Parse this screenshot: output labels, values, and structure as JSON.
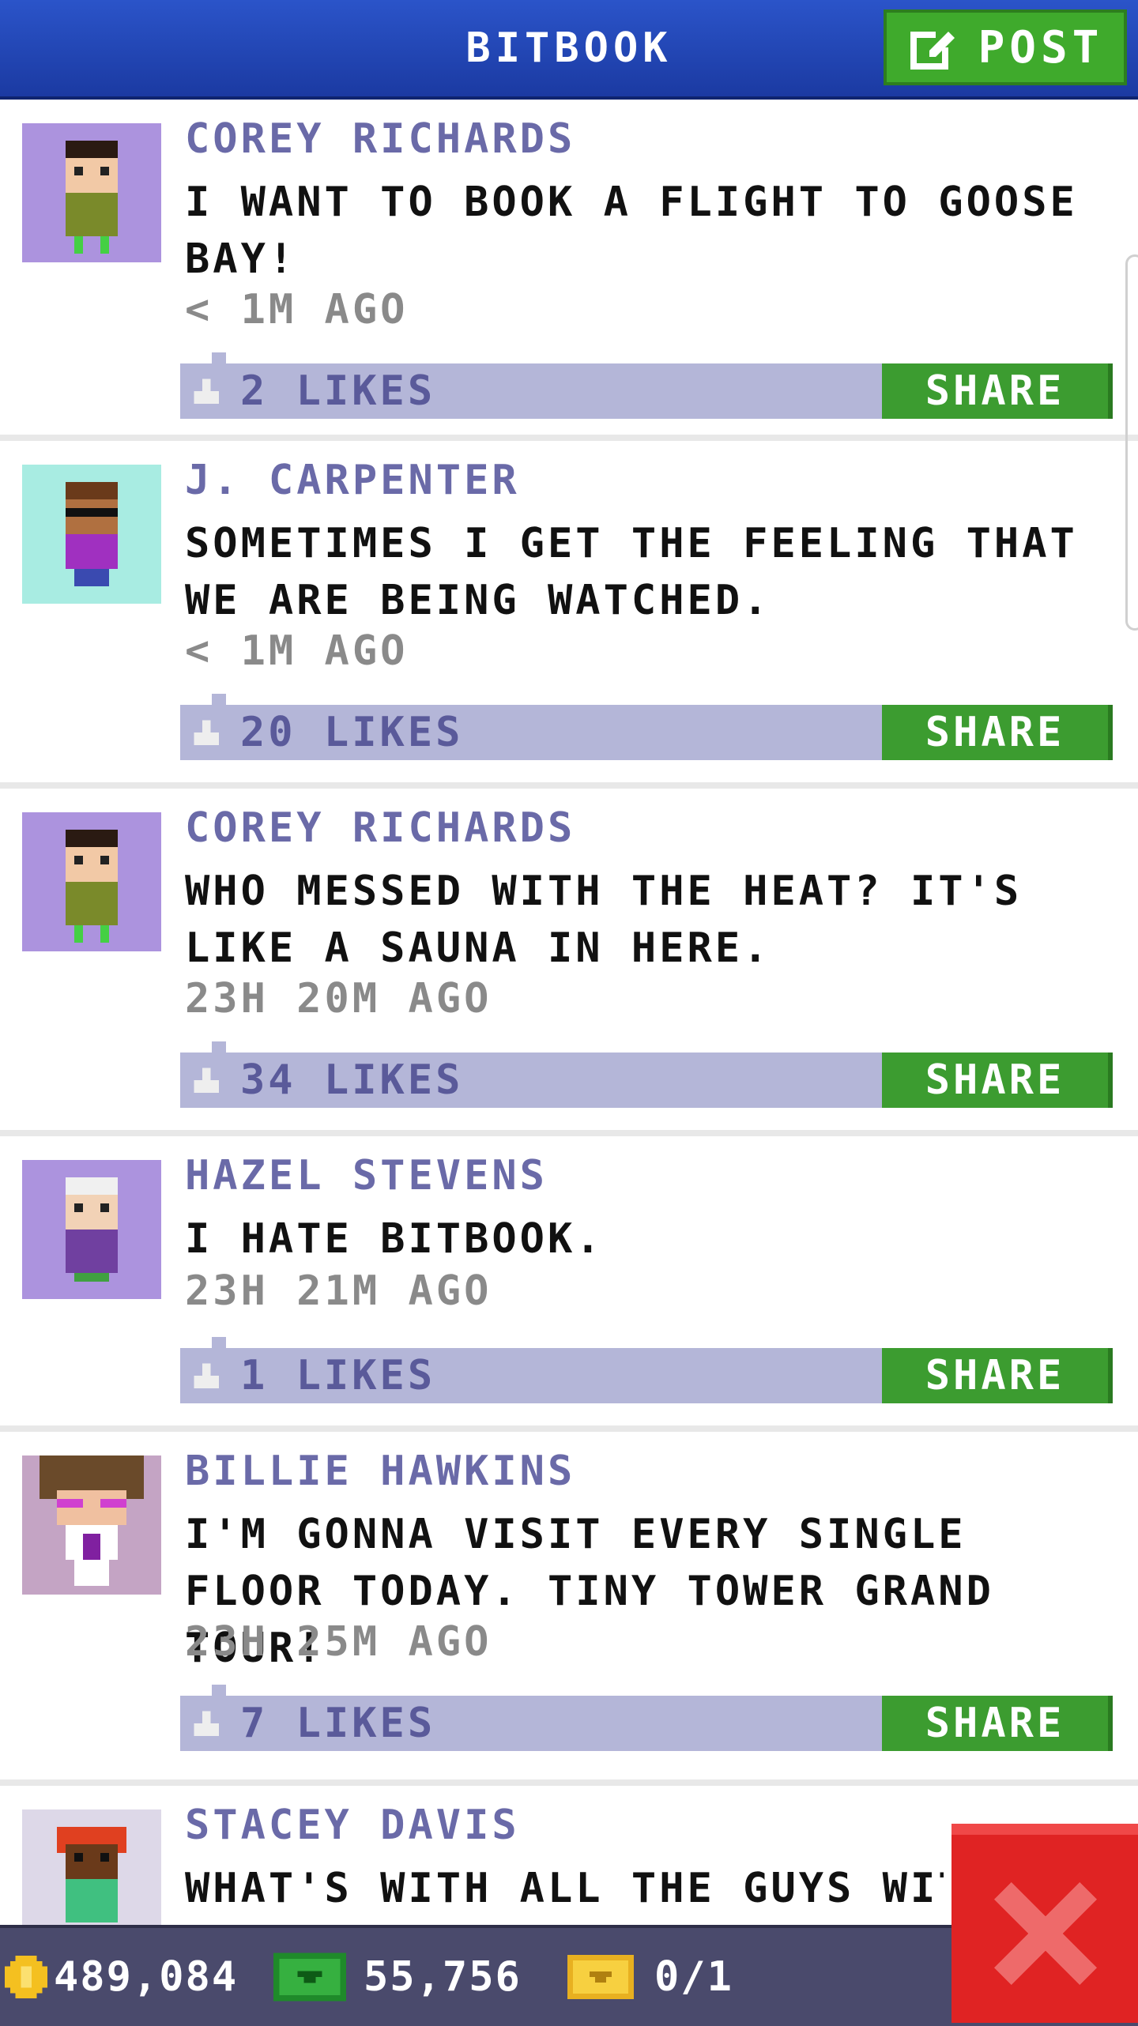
{
  "header": {
    "title": "BITBOOK",
    "post_label": "POST"
  },
  "posts": [
    {
      "author": "COREY RICHARDS",
      "text": "I WANT TO BOOK A FLIGHT TO GOOSE BAY!",
      "time": "< 1M AGO",
      "likes": "2 LIKES",
      "share_label": "SHARE",
      "avatar": "corey-richards-avatar"
    },
    {
      "author": "J. CARPENTER",
      "text": "SOMETIMES I GET THE FEELING THAT WE ARE BEING WATCHED.",
      "time": "< 1M AGO",
      "likes": "20 LIKES",
      "share_label": "SHARE",
      "avatar": "j-carpenter-avatar"
    },
    {
      "author": "COREY RICHARDS",
      "text": "WHO MESSED WITH THE HEAT? IT'S LIKE A SAUNA IN HERE.",
      "time": "23H 20M AGO",
      "likes": "34 LIKES",
      "share_label": "SHARE",
      "avatar": "corey-richards-avatar"
    },
    {
      "author": "HAZEL STEVENS",
      "text": "I HATE BITBOOK.",
      "time": "23H 21M AGO",
      "likes": "1 LIKES",
      "share_label": "SHARE",
      "avatar": "hazel-stevens-avatar"
    },
    {
      "author": "BILLIE HAWKINS",
      "text": "I'M GONNA VISIT EVERY SINGLE FLOOR TODAY. TINY TOWER GRAND TOUR!",
      "time": "23H 25M AGO",
      "likes": "7 LIKES",
      "share_label": "SHARE",
      "avatar": "billie-hawkins-avatar"
    },
    {
      "author": "STACEY DAVIS",
      "text": "WHAT'S WITH ALL THE GUYS WITH",
      "time": "",
      "likes": "",
      "share_label": "",
      "avatar": "stacey-davis-avatar"
    }
  ],
  "status": {
    "coins": "489,084",
    "bux": "55,756",
    "tickets": "0/1"
  },
  "colors": {
    "header": "#1f45b8",
    "accent_green": "#3faa2c",
    "likes_bar": "#b4b6d8",
    "close_red": "#e02323"
  }
}
